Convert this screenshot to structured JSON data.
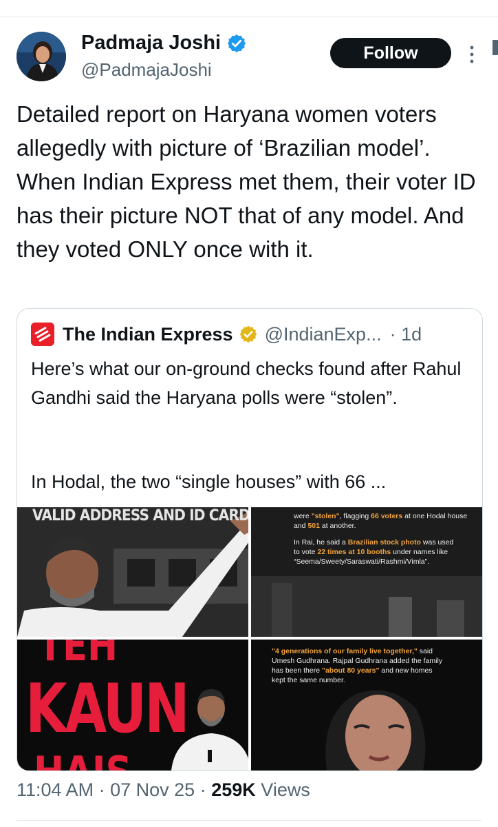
{
  "post": {
    "author_name": "Padmaja Joshi",
    "author_handle": "@PadmajaJoshi",
    "follow_label": "Follow",
    "text": "Detailed report on Haryana women voters allegedly with picture of ‘Brazilian model’. When Indian Express met them, their voter ID has their picture NOT that of any model. And they voted ONLY once with it.",
    "time": "11:04 AM",
    "date": "07 Nov 25",
    "views_count": "259K",
    "views_label": "Views",
    "separator": "·"
  },
  "quoted": {
    "author_name": "The Indian Express",
    "author_handle": "@IndianExp...",
    "age": "· 1d",
    "text_1": "Here’s what our on-ground checks found after Rahul Gandhi said the Haryana polls were “stolen”.",
    "text_2": "In Hodal, the two “single houses” with 66 ...",
    "images": {
      "tile1_caption": "VALID ADDRESS AND ID CARD",
      "tile2_line1_a": "were ",
      "tile2_line1_hl1": "\"stolen\"",
      "tile2_line1_b": ", flagging ",
      "tile2_line1_hl2": "66 voters",
      "tile2_line1_c": " at one Hodal house",
      "tile2_line2_a": "and ",
      "tile2_line2_hl": "501",
      "tile2_line2_b": " at another.",
      "tile2_line3_a": "In Rai, he said a ",
      "tile2_line3_hl": "Brazilian stock photo",
      "tile2_line3_b": " was used",
      "tile2_line4_a": "to vote ",
      "tile2_line4_hl": "22 times at 10 booths",
      "tile2_line4_b": " under names like",
      "tile2_line5": "“Seema/Sweety/Saraswati/Rashmi/Vimla”.",
      "tile3_top": "TEH",
      "tile3_word": "KAUN",
      "tile3_bottom": "HAIS",
      "tile4_line1_hl": "\"4 generations of our family live together,\"",
      "tile4_line1_b": " said",
      "tile4_line2": "Umesh Gudhrana. Rajpal Gudhrana added the family",
      "tile4_line3_a": "has been there ",
      "tile4_line3_hl": "\"about 80 years\"",
      "tile4_line3_b": " and new homes",
      "tile4_line4": "kept the same number."
    }
  },
  "colors": {
    "verified_blue": "#1d9bf0",
    "verified_gold": "#e2b719",
    "text_primary": "#0f1419",
    "text_secondary": "#536471",
    "highlight_orange": "#f2a23a",
    "kaun_red": "#e61e3c",
    "logo_red": "#e9202a"
  },
  "icons": {
    "verified": "verified-badge-icon",
    "more": "more-vertical-icon",
    "publication_logo": "indian-express-logo-icon"
  }
}
